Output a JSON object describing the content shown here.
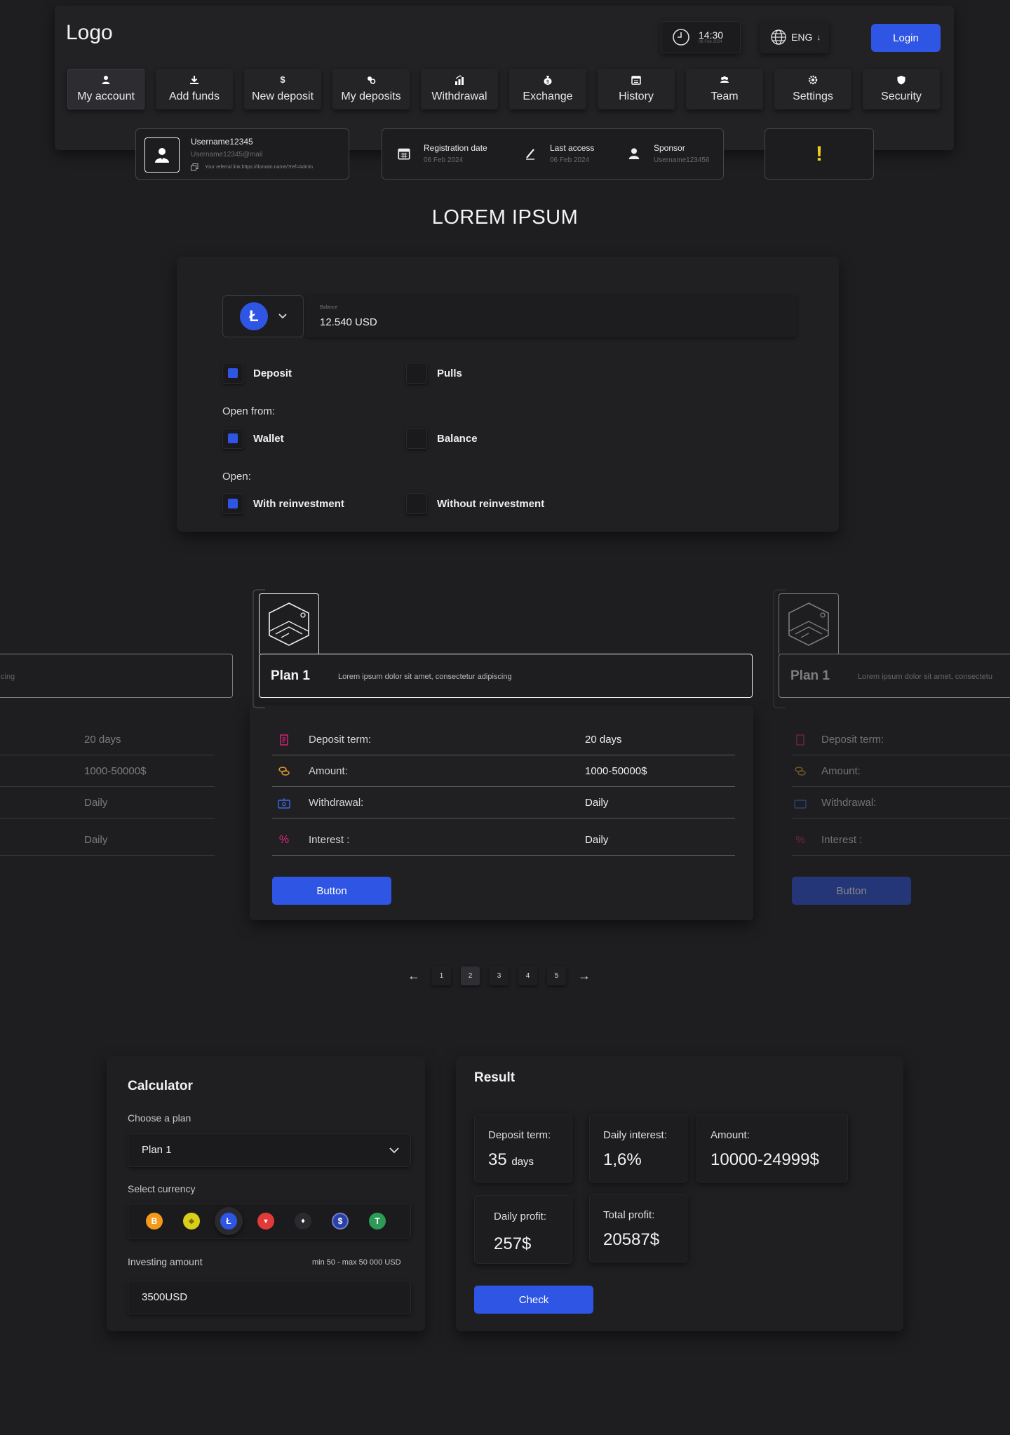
{
  "header": {
    "logo": "Logo",
    "time": "14:30",
    "date": "06 Feb 2024",
    "language": "ENG",
    "login_label": "Login"
  },
  "nav": [
    {
      "label": "My account",
      "icon": "user-icon",
      "active": true
    },
    {
      "label": "Add funds",
      "icon": "download-icon"
    },
    {
      "label": "New deposit",
      "icon": "dollar-icon"
    },
    {
      "label": "My deposits",
      "icon": "coins-icon"
    },
    {
      "label": "Withdrawal",
      "icon": "chart-up-icon"
    },
    {
      "label": "Exchange",
      "icon": "money-bag-icon"
    },
    {
      "label": "History",
      "icon": "calendar-icon"
    },
    {
      "label": "Team",
      "icon": "team-icon"
    },
    {
      "label": "Settings",
      "icon": "gear-icon"
    },
    {
      "label": "Security",
      "icon": "shield-icon"
    }
  ],
  "user": {
    "username": "Username12345",
    "email": "Username12345@mail",
    "referral": "Your referral link:https://domain.name/?ref=Admin"
  },
  "stats": {
    "registration_label": "Registration date",
    "registration_value": "06 Feb 2024",
    "last_access_label": "Last access",
    "last_access_value": "06 Feb 2024",
    "sponsor_label": "Sponsor",
    "sponsor_value": "Username123456"
  },
  "alert": {
    "symbol": "!"
  },
  "page_title": "LOREM IPSUM",
  "panel": {
    "balance_label": "Balance",
    "balance_value": "12.540 USD",
    "deposit_label": "Deposit",
    "pulls_label": "Pulls",
    "open_from_label": "Open from:",
    "wallet_label": "Wallet",
    "balance_opt_label": "Balance",
    "open_label": "Open:",
    "with_reinvest_label": "With reinvestment",
    "without_reinvest_label": "Without reinvestment"
  },
  "plans": {
    "left_desc_tail": "cing",
    "title": "Plan 1",
    "desc": "Lorem ipsum dolor sit amet, consectetur adipiscing",
    "right_desc": "Lorem ipsum dolor sit amet, consectetu",
    "rows": [
      {
        "label": "Deposit term:",
        "value": "20 days",
        "icon": "document-icon",
        "color": "#e0247a"
      },
      {
        "label": "Amount:",
        "value": "1000-50000$",
        "icon": "coins-icon",
        "color": "#e39b2c"
      },
      {
        "label": "Withdrawal:",
        "value": "Daily",
        "icon": "wallet-icon",
        "color": "#3f6be8"
      },
      {
        "label": "Interest :",
        "value": "Daily",
        "icon": "percent-icon",
        "color": "#e0247a"
      }
    ],
    "button_label": "Button"
  },
  "pagination": {
    "pages": [
      "1",
      "2",
      "3",
      "4",
      "5"
    ],
    "current": "2",
    "prev": "←",
    "next": "→"
  },
  "calculator": {
    "title": "Calculator",
    "choose_plan_label": "Choose a plan",
    "plan_value": "Plan 1",
    "select_currency_label": "Select currency",
    "currencies": [
      {
        "name": "bitcoin-icon",
        "symbol": "B",
        "color": "#f39a1c"
      },
      {
        "name": "binance-icon",
        "symbol": "◆",
        "color": "#d9cf1a"
      },
      {
        "name": "litecoin-icon",
        "symbol": "Ł",
        "color": "#2f55e4"
      },
      {
        "name": "tron-icon",
        "symbol": "▼",
        "color": "#e23a3a"
      },
      {
        "name": "ethereum-icon",
        "symbol": "♦",
        "color": "#2b2b2f"
      },
      {
        "name": "usdc-icon",
        "symbol": "$",
        "color": "#2a3fa8"
      },
      {
        "name": "tether-icon",
        "symbol": "T",
        "color": "#2e9a58"
      }
    ],
    "investing_label": "Investing amount",
    "limits": "min 50 - max 50 000 USD",
    "amount_value": "3500USD"
  },
  "result": {
    "title": "Result",
    "deposit_term_label": "Deposit term:",
    "deposit_term_value": "35",
    "deposit_term_unit": "days",
    "daily_interest_label": "Daily interest:",
    "daily_interest_value": "1,6%",
    "amount_label": "Amount:",
    "amount_value": "10000-24999$",
    "daily_profit_label": "Daily profit:",
    "daily_profit_value": "257$",
    "total_profit_label": "Total profit:",
    "total_profit_value": "20587$",
    "check_label": "Check"
  },
  "colors": {
    "accent": "#2f55e4",
    "alert": "#f0d21c",
    "background": "#1e1e20"
  }
}
